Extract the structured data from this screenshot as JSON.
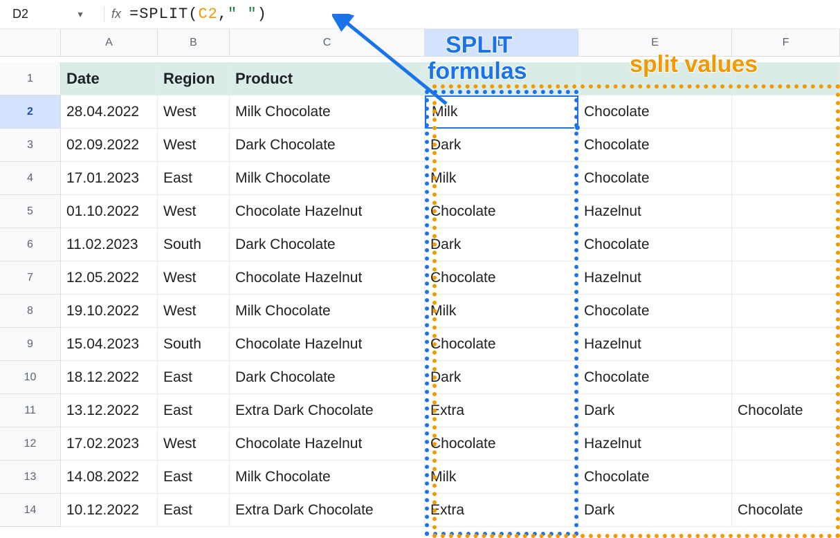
{
  "namebox": {
    "cell": "D2"
  },
  "formula": {
    "prefix": "=SPLIT(",
    "ref": "C2",
    "mid": ",",
    "str": "\" \"",
    "suffix": ")"
  },
  "columns": [
    "A",
    "B",
    "C",
    "D",
    "E",
    "F"
  ],
  "headers": {
    "A": "Date",
    "B": "Region",
    "C": "Product"
  },
  "rows": [
    {
      "n": 2,
      "date": "28.04.2022",
      "region": "West",
      "product": "Milk Chocolate",
      "d": "Milk",
      "e": "Chocolate",
      "f": ""
    },
    {
      "n": 3,
      "date": "02.09.2022",
      "region": "West",
      "product": "Dark Chocolate",
      "d": "Dark",
      "e": "Chocolate",
      "f": ""
    },
    {
      "n": 4,
      "date": "17.01.2023",
      "region": "East",
      "product": "Milk Chocolate",
      "d": "Milk",
      "e": "Chocolate",
      "f": ""
    },
    {
      "n": 5,
      "date": "01.10.2022",
      "region": "West",
      "product": "Chocolate Hazelnut",
      "d": "Chocolate",
      "e": "Hazelnut",
      "f": ""
    },
    {
      "n": 6,
      "date": "11.02.2023",
      "region": "South",
      "product": "Dark Chocolate",
      "d": "Dark",
      "e": "Chocolate",
      "f": ""
    },
    {
      "n": 7,
      "date": "12.05.2022",
      "region": "West",
      "product": "Chocolate Hazelnut",
      "d": "Chocolate",
      "e": "Hazelnut",
      "f": ""
    },
    {
      "n": 8,
      "date": "19.10.2022",
      "region": "West",
      "product": "Milk Chocolate",
      "d": "Milk",
      "e": "Chocolate",
      "f": ""
    },
    {
      "n": 9,
      "date": "15.04.2023",
      "region": "South",
      "product": "Chocolate Hazelnut",
      "d": "Chocolate",
      "e": "Hazelnut",
      "f": ""
    },
    {
      "n": 10,
      "date": "18.12.2022",
      "region": "East",
      "product": "Dark Chocolate",
      "d": "Dark",
      "e": "Chocolate",
      "f": ""
    },
    {
      "n": 11,
      "date": "13.12.2022",
      "region": "East",
      "product": "Extra Dark Chocolate",
      "d": "Extra",
      "e": "Dark",
      "f": "Chocolate"
    },
    {
      "n": 12,
      "date": "17.02.2023",
      "region": "West",
      "product": "Chocolate Hazelnut",
      "d": "Chocolate",
      "e": "Hazelnut",
      "f": ""
    },
    {
      "n": 13,
      "date": "14.08.2022",
      "region": "East",
      "product": "Milk Chocolate",
      "d": "Milk",
      "e": "Chocolate",
      "f": ""
    },
    {
      "n": 14,
      "date": "10.12.2022",
      "region": "East",
      "product": "Extra Dark Chocolate",
      "d": "Extra",
      "e": "Dark",
      "f": "Chocolate"
    }
  ],
  "annotations": {
    "splitformulas1": "SPLIT",
    "splitformulas2": "formulas",
    "splitvalues": "split values"
  }
}
